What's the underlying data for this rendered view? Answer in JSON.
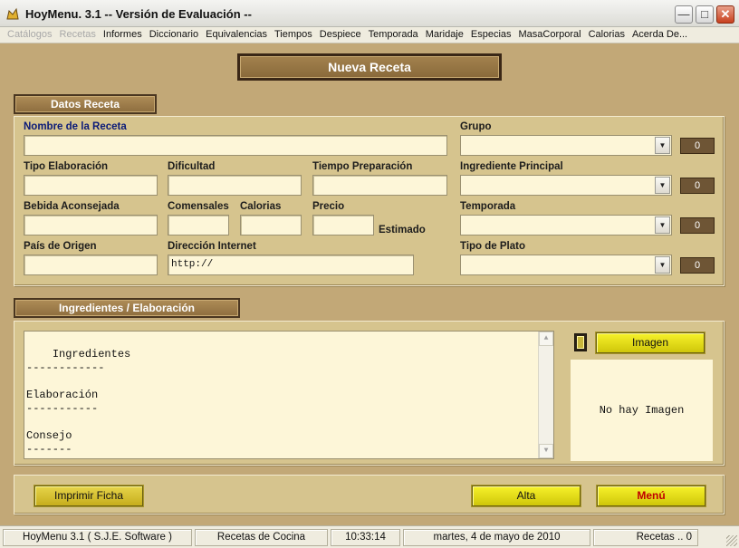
{
  "window": {
    "title": "HoyMenu. 3.1 -- Versión de Evaluación --"
  },
  "menu": [
    {
      "label": "Catálogos",
      "disabled": true
    },
    {
      "label": "Recetas",
      "disabled": true
    },
    {
      "label": "Informes",
      "disabled": false
    },
    {
      "label": "Diccionario",
      "disabled": false
    },
    {
      "label": "Equivalencias",
      "disabled": false
    },
    {
      "label": "Tiempos",
      "disabled": false
    },
    {
      "label": "Despiece",
      "disabled": false
    },
    {
      "label": "Temporada",
      "disabled": false
    },
    {
      "label": "Maridaje",
      "disabled": false
    },
    {
      "label": "Especias",
      "disabled": false
    },
    {
      "label": "MasaCorporal",
      "disabled": false
    },
    {
      "label": "Calorias",
      "disabled": false
    },
    {
      "label": "Acerda De...",
      "disabled": false
    }
  ],
  "banner": {
    "title": "Nueva Receta"
  },
  "datos": {
    "section_title": "Datos Receta",
    "nombre_label": "Nombre de la Receta",
    "nombre_value": "",
    "tipo_label": "Tipo Elaboración",
    "dificultad_label": "Dificultad",
    "tiempo_label": "Tiempo Preparación",
    "bebida_label": "Bebida Aconsejada",
    "comensales_label": "Comensales",
    "calorias_label": "Calorias",
    "precio_label": "Precio",
    "estimado_label": "Estimado",
    "pais_label": "País de Origen",
    "direccion_label": "Dirección Internet",
    "direccion_value": "http://",
    "grupo_label": "Grupo",
    "grupo_count": "0",
    "ingrediente_label": "Ingrediente Principal",
    "ingrediente_count": "0",
    "temporada_label": "Temporada",
    "temporada_count": "0",
    "tipo_plato_label": "Tipo de Plato",
    "tipo_plato_count": "0"
  },
  "ingredientes": {
    "section_title": "Ingredientes / Elaboración",
    "text": "Ingredientes\n------------\n\nElaboración\n-----------\n\nConsejo\n-------",
    "imagen_button": "Imagen",
    "no_image_text": "No hay Imagen"
  },
  "buttons": {
    "imprimir": "Imprimir Ficha",
    "alta": "Alta",
    "menu": "Menú"
  },
  "status": {
    "app": "HoyMenu 3.1  ( S.J.E. Software )",
    "module": "Recetas de Cocina",
    "time": "10:33:14",
    "date": "martes, 4 de mayo de 2010",
    "count": "Recetas ..  0"
  },
  "colors": {
    "background": "#c2a877",
    "panel": "#d6c48e",
    "field": "#fdf6d8",
    "button_yellow": "#e9e21e",
    "label_blue": "#0a1a78",
    "menu_red": "#c00000"
  }
}
